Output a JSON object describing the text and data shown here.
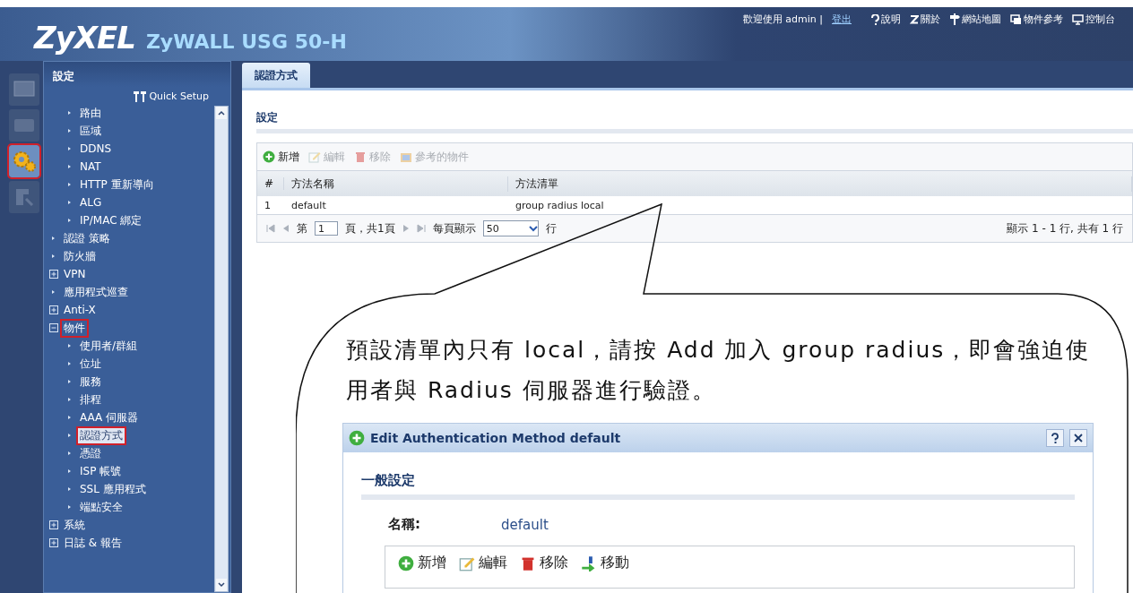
{
  "header": {
    "logo": "ZyXEL",
    "product": "ZyWALL USG 50-H",
    "welcome": "歡迎使用",
    "user": "admin",
    "separator": "|",
    "logout": "登出",
    "links": [
      {
        "label": "說明",
        "kind": "help"
      },
      {
        "label": "關於",
        "kind": "about"
      },
      {
        "label": "網站地圖",
        "kind": "sitemap"
      },
      {
        "label": "物件參考",
        "kind": "objects"
      },
      {
        "label": "控制台",
        "kind": "console"
      }
    ]
  },
  "icon_bar": [
    {
      "kind": "dashboard",
      "selected": false,
      "marked": false
    },
    {
      "kind": "monitor",
      "selected": false,
      "marked": false
    },
    {
      "kind": "configuration",
      "selected": true,
      "marked": true
    },
    {
      "kind": "maintenance",
      "selected": false,
      "marked": false
    }
  ],
  "sidebar": {
    "title": "設定",
    "quick_setup": "Quick Setup",
    "items": [
      {
        "children": [
          {
            "label": "路由",
            "kind": "link",
            "selected": false,
            "marked": false
          },
          {
            "label": "區域",
            "kind": "link",
            "selected": false,
            "marked": false
          },
          {
            "label": "DDNS",
            "kind": "link",
            "selected": false,
            "marked": false
          },
          {
            "label": "NAT",
            "kind": "link",
            "selected": false,
            "marked": false
          },
          {
            "label": "HTTP 重新導向",
            "kind": "link",
            "selected": false,
            "marked": false
          },
          {
            "label": "ALG",
            "kind": "link",
            "selected": false,
            "marked": false
          },
          {
            "label": "IP/MAC 綁定",
            "kind": "link",
            "selected": false,
            "marked": false
          }
        ]
      },
      {
        "label": "認證 策略",
        "kind": "link",
        "selected": false,
        "marked": false
      },
      {
        "label": "防火牆",
        "kind": "link",
        "selected": false,
        "marked": false
      },
      {
        "label": "VPN",
        "kind": "group",
        "expanded": false,
        "selected": false,
        "marked": false
      },
      {
        "label": "應用程式巡查",
        "kind": "link",
        "selected": false,
        "marked": false
      },
      {
        "label": "Anti-X",
        "kind": "group",
        "expanded": false,
        "selected": false,
        "marked": false
      },
      {
        "label": "物件",
        "kind": "group",
        "expanded": true,
        "selected": false,
        "marked": true,
        "children": [
          {
            "label": "使用者/群組",
            "kind": "link",
            "selected": false,
            "marked": false
          },
          {
            "label": "位址",
            "kind": "link",
            "selected": false,
            "marked": false
          },
          {
            "label": "服務",
            "kind": "link",
            "selected": false,
            "marked": false
          },
          {
            "label": "排程",
            "kind": "link",
            "selected": false,
            "marked": false
          },
          {
            "label": "AAA 伺服器",
            "kind": "link",
            "selected": false,
            "marked": false
          },
          {
            "label": "認證方式",
            "kind": "link",
            "selected": true,
            "marked": true
          },
          {
            "label": "憑證",
            "kind": "link",
            "selected": false,
            "marked": false
          },
          {
            "label": "ISP 帳號",
            "kind": "link",
            "selected": false,
            "marked": false
          },
          {
            "label": "SSL 應用程式",
            "kind": "link",
            "selected": false,
            "marked": false
          },
          {
            "label": "端點安全",
            "kind": "link",
            "selected": false,
            "marked": false
          }
        ]
      },
      {
        "label": "系統",
        "kind": "group",
        "expanded": false,
        "selected": false,
        "marked": false
      },
      {
        "label": "日誌 & 報告",
        "kind": "group",
        "expanded": false,
        "selected": false,
        "marked": false
      }
    ]
  },
  "tabs": [
    {
      "label": "認證方式",
      "selected": true
    }
  ],
  "section": "設定",
  "toolbar": [
    {
      "label": "新增",
      "kind": "add",
      "disabled": false
    },
    {
      "label": "編輯",
      "kind": "edit",
      "disabled": true
    },
    {
      "label": "移除",
      "kind": "remove",
      "disabled": true
    },
    {
      "label": "參考的物件",
      "kind": "references",
      "disabled": true
    }
  ],
  "table": {
    "columns": [
      "#",
      "方法名稱",
      "方法清單"
    ],
    "rows": [
      [
        "1",
        "default",
        "group radius local"
      ]
    ]
  },
  "pager": {
    "page_prefix": "第",
    "page": "1",
    "page_suffix": "頁，共1頁",
    "per_page_label": "每頁顯示",
    "per_page": "50",
    "per_page_unit": "行",
    "summary": "顯示 1 - 1 行, 共有 1 行"
  },
  "callout": {
    "text": "預設清單內只有 local，請按 Add  加入 group radius，即會強迫使用者與 Radius 伺服器進行驗證。",
    "dialog": {
      "title": "Edit Authentication Method default",
      "section": "一般設定",
      "name_label": "名稱:",
      "name_value": "default",
      "toolbar": [
        {
          "label": "新增",
          "kind": "add"
        },
        {
          "label": "編輯",
          "kind": "edit"
        },
        {
          "label": "移除",
          "kind": "remove"
        },
        {
          "label": "移動",
          "kind": "move"
        }
      ]
    }
  }
}
